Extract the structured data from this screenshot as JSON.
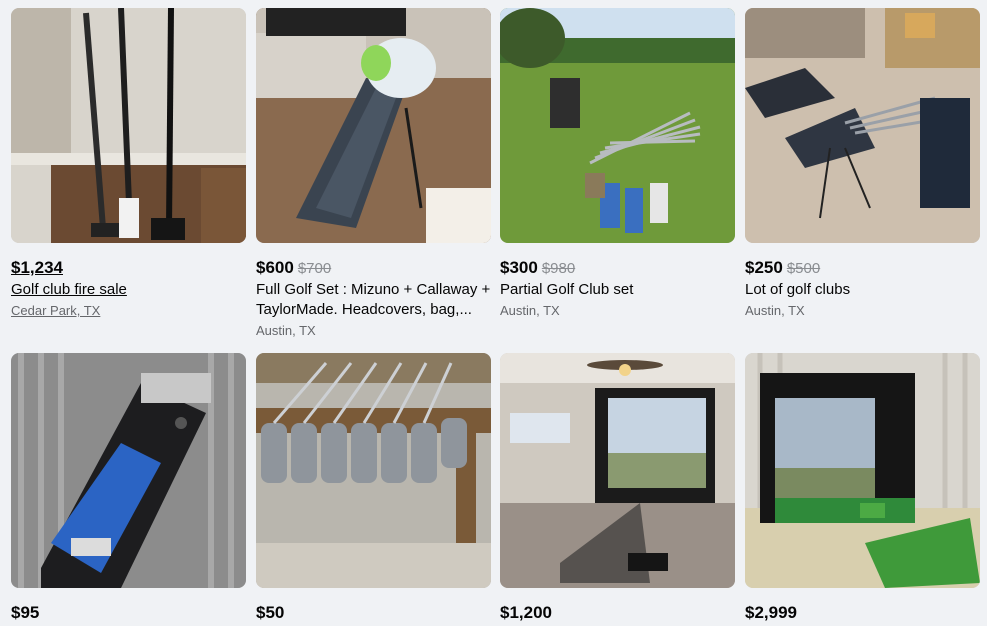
{
  "listings": [
    {
      "price": "$1,234",
      "old_price": "",
      "title": "Golf club fire sale",
      "location": "Cedar Park, TX",
      "image": "putters-against-wall"
    },
    {
      "price": "$600",
      "old_price": "$700",
      "title": "Full Golf Set : Mizuno + Callaway + TaylorMade. Headcovers, bag,...",
      "location": "Austin, TX",
      "image": "golf-bag-on-floor"
    },
    {
      "price": "$300",
      "old_price": "$980",
      "title": "Partial Golf Club set",
      "location": "Austin, TX",
      "image": "clubs-on-grass"
    },
    {
      "price": "$250",
      "old_price": "$500",
      "title": "Lot of golf clubs",
      "location": "Austin, TX",
      "image": "bags-in-garage"
    },
    {
      "price": "$95",
      "old_price": "",
      "title": "",
      "location": "",
      "image": "blue-golf-bag"
    },
    {
      "price": "$50",
      "old_price": "",
      "title": "",
      "location": "",
      "image": "wedges-on-table"
    },
    {
      "price": "$1,200",
      "old_price": "",
      "title": "",
      "location": "",
      "image": "golf-simulator-room"
    },
    {
      "price": "$2,999",
      "old_price": "",
      "title": "",
      "location": "",
      "image": "golf-simulator-hitting-mat"
    }
  ]
}
